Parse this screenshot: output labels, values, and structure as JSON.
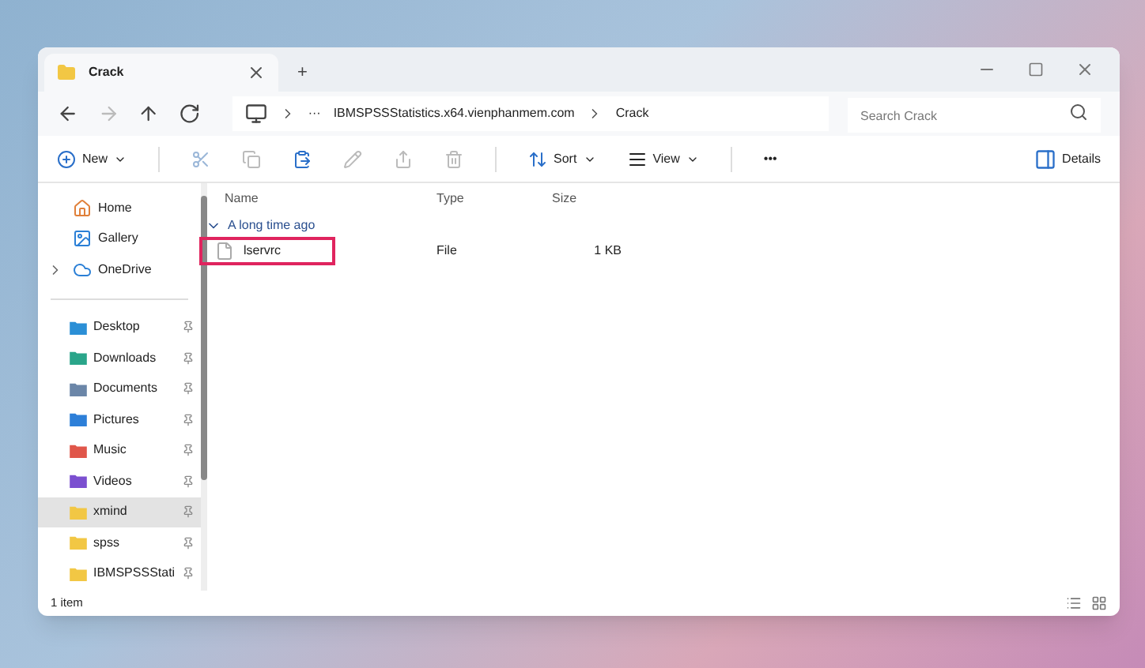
{
  "window": {
    "tab_title": "Crack",
    "new_tab": "+"
  },
  "address_bar": {
    "ellipsis": "···",
    "crumbs": [
      "IBMSPSSStatistics.x64.vienphanmem.com",
      "Crack"
    ]
  },
  "search": {
    "placeholder": "Search Crack"
  },
  "toolbar": {
    "new": "New",
    "sort": "Sort",
    "view": "View",
    "more": "•••",
    "details": "Details"
  },
  "sidebar": {
    "quick": [
      {
        "label": "Home",
        "expandable": false
      },
      {
        "label": "Gallery",
        "expandable": false
      },
      {
        "label": "OneDrive",
        "expandable": true
      }
    ],
    "pinned": [
      {
        "label": "Desktop",
        "color": "#2b8fd6",
        "selected": false
      },
      {
        "label": "Downloads",
        "color": "#2aa58a",
        "selected": false
      },
      {
        "label": "Documents",
        "color": "#6b86a8",
        "selected": false
      },
      {
        "label": "Pictures",
        "color": "#2d7fd8",
        "selected": false
      },
      {
        "label": "Music",
        "color": "#e0564a",
        "selected": false
      },
      {
        "label": "Videos",
        "color": "#7b4fd0",
        "selected": false
      },
      {
        "label": "xmind",
        "color": "#f2c744",
        "selected": true
      },
      {
        "label": "spss",
        "color": "#f2c744",
        "selected": false
      },
      {
        "label": "IBMSPSSStati",
        "color": "#f2c744",
        "selected": false
      }
    ]
  },
  "table": {
    "columns": [
      "Name",
      "Type",
      "Size"
    ],
    "group": "A long time ago",
    "rows": [
      {
        "name": "lservrc",
        "type": "File",
        "size": "1 KB",
        "highlighted": true
      }
    ]
  },
  "status_bar": {
    "count": "1 item"
  }
}
